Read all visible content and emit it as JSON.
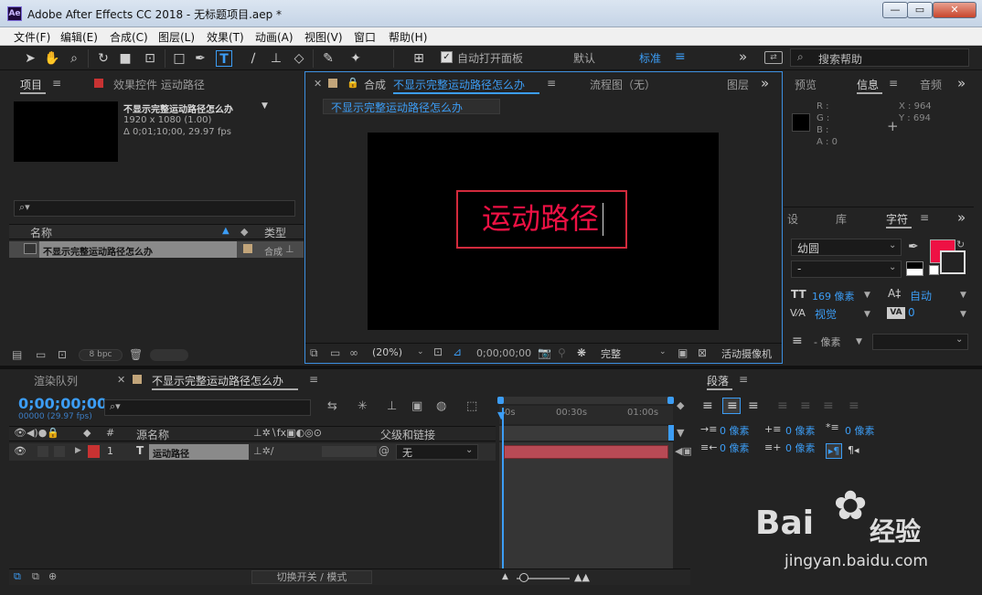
{
  "window": {
    "title": "Adobe After Effects CC 2018 - 无标题项目.aep *",
    "icon": "Ae",
    "controls": [
      "—",
      "▭",
      "✕"
    ]
  },
  "menubar": [
    "文件(F)",
    "编辑(E)",
    "合成(C)",
    "图层(L)",
    "效果(T)",
    "动画(A)",
    "视图(V)",
    "窗口",
    "帮助(H)"
  ],
  "toolbar": {
    "auto_open": "自动打开面板",
    "workspaces": [
      "默认",
      "标准"
    ],
    "search_placeholder": "搜索帮助",
    "more": "»"
  },
  "project": {
    "tab": "项目",
    "effects_tab": "效果控件 运动路径",
    "comp_name": "不显示完整运动路径怎么办",
    "comp_size": "1920 x 1080 (1.00)",
    "comp_duration": "Δ 0;01;10;00, 29.97 fps",
    "col_name": "名称",
    "col_type": "类型",
    "item_name": "不显示完整运动路径怎么办",
    "item_type": "合成",
    "bpc": "8 bpc"
  },
  "composition": {
    "tab_prefix": "合成",
    "tab_name": "不显示完整运动路径怎么办",
    "flow_tab": "流程图（无）",
    "layer_tab": "图层",
    "subtab": "不显示完整运动路径怎么办",
    "text": "运动路径",
    "zoom": "(20%)",
    "timecode": "0;00;00;00",
    "quality": "完整",
    "camera": "活动摄像机"
  },
  "info": {
    "tabs": [
      "预览",
      "信息",
      "音频"
    ],
    "rgba": [
      "R :",
      "G :",
      "B :",
      "A : 0"
    ],
    "x": "X : 964",
    "y": "Y : 694"
  },
  "character": {
    "tabs": [
      "设",
      "库",
      "字符"
    ],
    "font": "幼圆",
    "style": "-",
    "size": "169 像素",
    "leading": "自动",
    "kerning": "视觉",
    "tracking": "0",
    "stroke": "- 像素",
    "fill_color": "#ee1144"
  },
  "renderqueue": {
    "tab": "渲染队列"
  },
  "timeline": {
    "tab": "不显示完整运动路径怎么办",
    "timecode": "0;00;00;00",
    "fps": "00000 (29.97 fps)",
    "col_hash": "#",
    "col_source": "源名称",
    "col_parent": "父级和链接",
    "layer_num": "1",
    "layer_type": "T",
    "layer_name": "运动路径",
    "parent_value": "无",
    "ruler": [
      "0s",
      "00:30s",
      "01:00s"
    ],
    "toggle": "切换开关 / 模式",
    "label_color": "#c83232",
    "bar_color": "#b84a55"
  },
  "paragraph": {
    "tab": "段落",
    "indent": [
      "0 像素",
      "0 像素",
      "0 像素",
      "0 像素",
      "0 像素"
    ]
  },
  "watermark": {
    "brand": "Bai",
    "brand2": "经验",
    "url": "jingyan.baidu.com"
  }
}
